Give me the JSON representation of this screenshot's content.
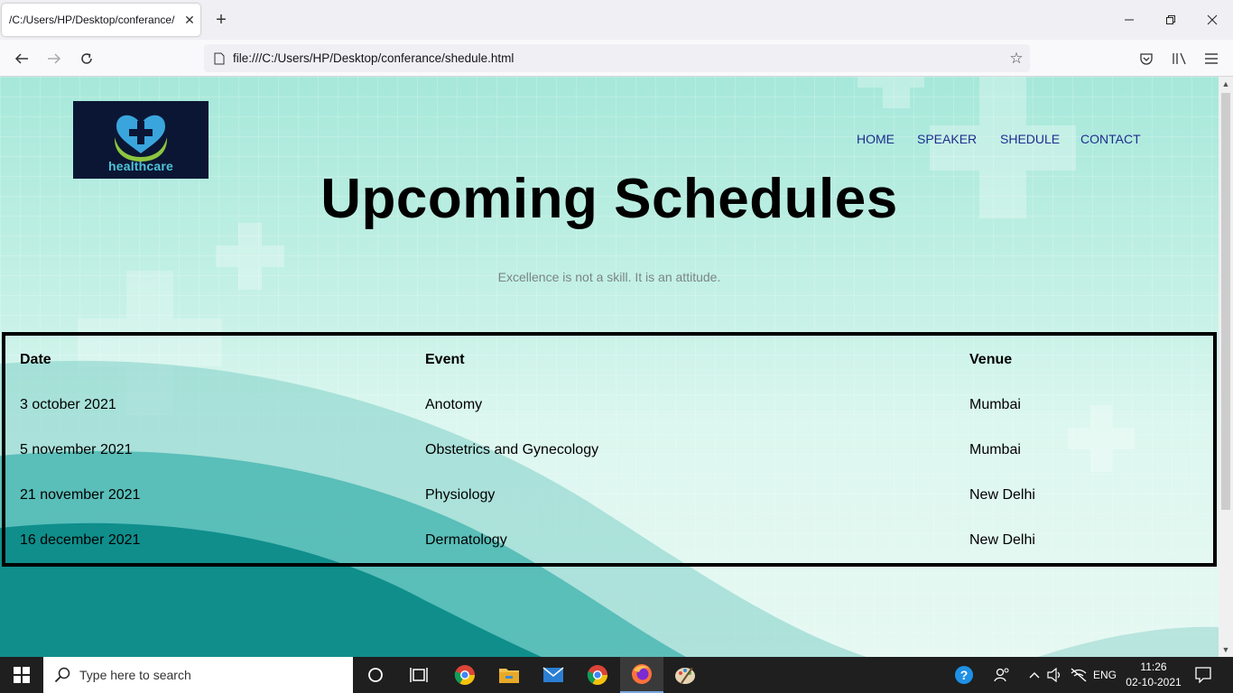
{
  "browser": {
    "tab_title": "/C:/Users/HP/Desktop/conferance/",
    "tab_close": "✕",
    "new_tab": "+",
    "url": "file:///C:/Users/HP/Desktop/conferance/shedule.html"
  },
  "site": {
    "logo_text": "healthcare",
    "nav": [
      "HOME",
      "SPEAKER",
      "SHEDULE",
      "CONTACT"
    ],
    "title": "Upcoming Schedules",
    "tagline": "Excellence is not a skill. It is an attitude."
  },
  "schedule": {
    "headers": [
      "Date",
      "Event",
      "Venue"
    ],
    "rows": [
      [
        "3 october 2021",
        "Anotomy",
        "Mumbai"
      ],
      [
        "5 november 2021",
        "Obstetrics and Gynecology",
        "Mumbai"
      ],
      [
        "21 november 2021",
        "Physiology",
        "New Delhi"
      ],
      [
        "16 december 2021",
        "Dermatology",
        "New Delhi"
      ]
    ]
  },
  "taskbar": {
    "search_placeholder": "Type here to search",
    "language": "ENG",
    "time": "11:26",
    "date": "02-10-2021"
  },
  "colors": {
    "nav_link": "#1f2d8f",
    "logo_bg": "#0b1634",
    "wave_dark": "#0f8e8c"
  }
}
